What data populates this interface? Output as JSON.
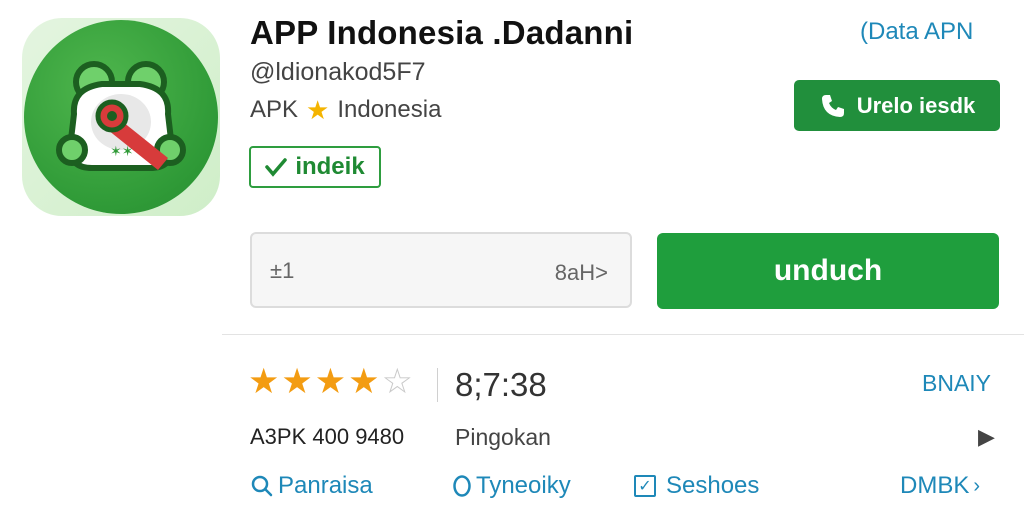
{
  "app": {
    "title": "APP Indonesia .Dadanni",
    "handle": "@ldionakod5F7",
    "type_label": "APK",
    "region": "Indonesia",
    "tag_label": "indeik"
  },
  "header": {
    "top_link": "(Data  APN",
    "support_button": "Urelo iesdk"
  },
  "download": {
    "version_left": "±1",
    "version_right": "8aH>",
    "button_label": "unduch"
  },
  "stats": {
    "rating": 4.5,
    "rating_max": 5,
    "rating_count": "8;7:38",
    "right_link": "BNAIY",
    "size_label": "A3PK  400 9480",
    "category": "Pingokan"
  },
  "bottom_nav": {
    "item1": "Panraisa",
    "item2": "Tyneoiky",
    "item3": "Seshoes",
    "item4": "DMBK"
  },
  "colors": {
    "brand_green": "#1f9e3d",
    "link_blue": "#1e88b8",
    "star_gold": "#f39c12"
  },
  "icons": {
    "app_icon": "frog-mascot-icon",
    "star": "star-icon",
    "tag": "check-leaf-icon",
    "support": "phone-icon",
    "search": "search-icon",
    "circle": "circle-icon",
    "checkbox": "checkbox-icon",
    "chevron": "chevron-right-icon"
  }
}
